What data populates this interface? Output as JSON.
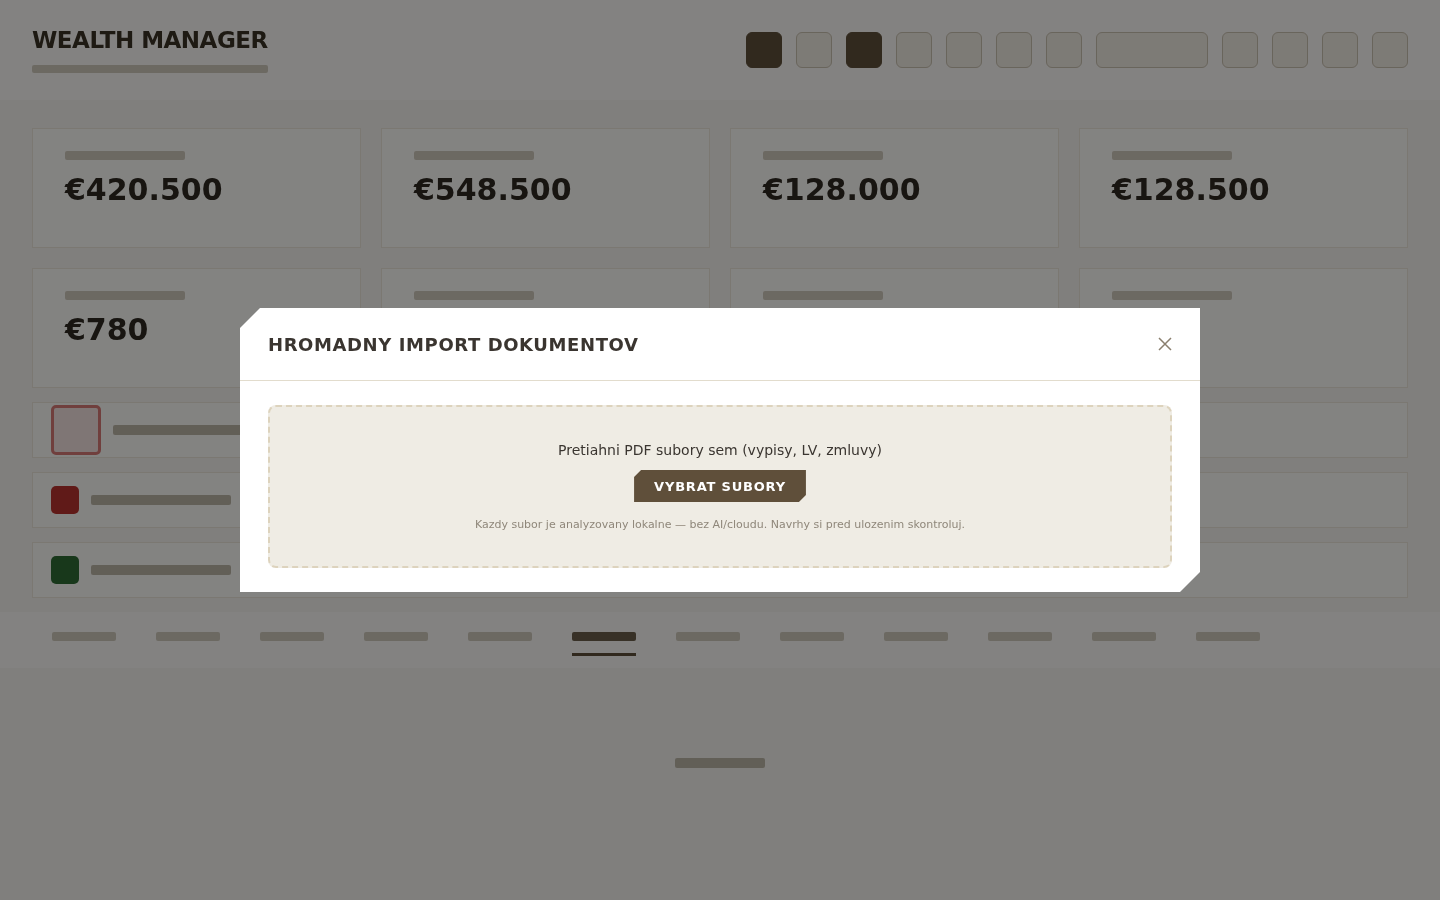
{
  "app": {
    "title": "WEALTH MANAGER"
  },
  "stats": [
    {
      "value": "€420.500"
    },
    {
      "value": "€548.500"
    },
    {
      "value": "€128.000"
    },
    {
      "value": "€128.500"
    },
    {
      "value": "€780"
    }
  ],
  "alerts": [
    {
      "kind": "outline"
    },
    {
      "kind": "danger"
    },
    {
      "kind": "success"
    }
  ],
  "tabs": [
    {
      "selected": false
    },
    {
      "selected": false
    },
    {
      "selected": false
    },
    {
      "selected": false
    },
    {
      "selected": false
    },
    {
      "selected": true
    },
    {
      "selected": false
    },
    {
      "selected": false
    },
    {
      "selected": false
    },
    {
      "selected": false
    },
    {
      "selected": false
    },
    {
      "selected": false
    }
  ],
  "dialog": {
    "title": "HROMADNY IMPORT DOKUMENTOV",
    "dropzone": {
      "prompt": "Pretiahni PDF subory sem (vypisy, LV, zmluvy)",
      "button": "VYBRAT SUBORY",
      "note": "Kazdy subor je analyzovany lokalne — bez AI/cloudu. Navrhy si pred ulozenim skontroluj."
    }
  }
}
